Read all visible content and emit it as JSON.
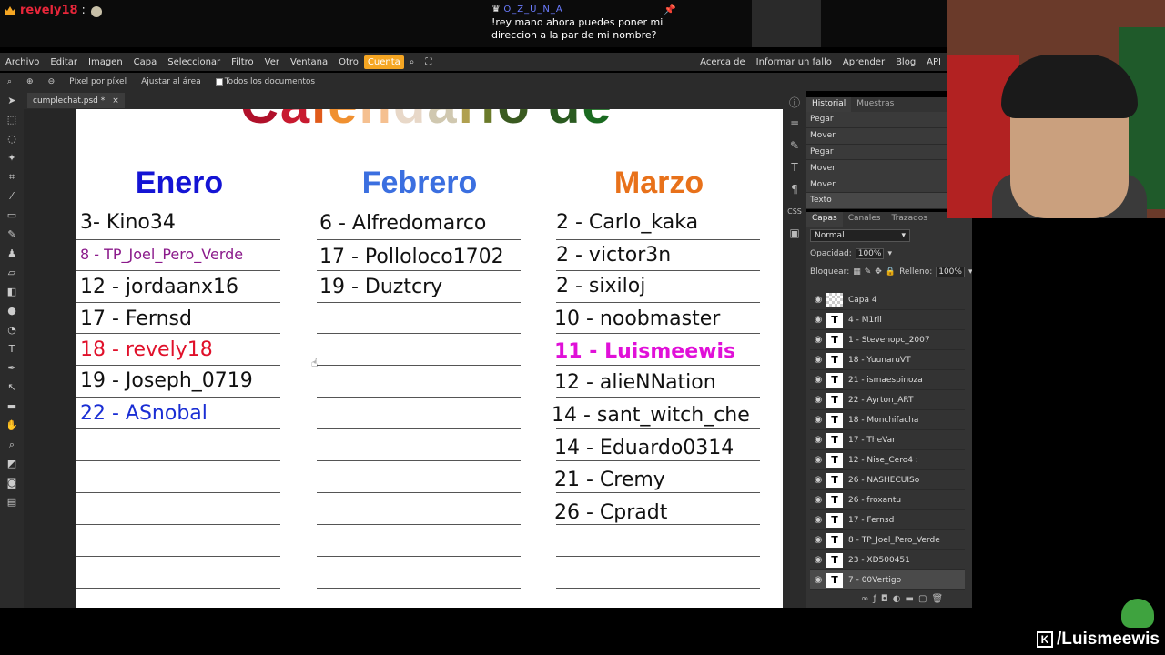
{
  "chat": {
    "msg1_user": "revely18",
    "msg1_sep": ":",
    "msg2_user": "O_Z_U_N_A",
    "msg2_text": "!rey mano ahora puedes poner mi direccion a la par de mi nombre?"
  },
  "menubar": {
    "items": [
      "Archivo",
      "Editar",
      "Imagen",
      "Capa",
      "Seleccionar",
      "Filtro",
      "Ver",
      "Ventana",
      "Otro",
      "Cuenta"
    ],
    "right_items": [
      "Acerca de",
      "Informar un fallo",
      "Aprender",
      "Blog",
      "API"
    ]
  },
  "options": {
    "pixel": "Píxel por píxel",
    "fit": "Ajustar al área",
    "all_docs": "Todos los documentos"
  },
  "document": {
    "tab_title": "cumplechat.psd *",
    "close": "×"
  },
  "canvas": {
    "months": [
      {
        "title": "Enero",
        "color": "#1414d4",
        "entries": [
          {
            "text": "3- Kino34",
            "color": "#111"
          },
          {
            "text": "8 - TP_Joel_Pero_Verde",
            "color": "#8b1a8b"
          },
          {
            "text": "12 - jordaanx16",
            "color": "#111"
          },
          {
            "text": "17 - Fernsd",
            "color": "#111"
          },
          {
            "text": "18 - revely18",
            "color": "#e0102a"
          },
          {
            "text": "19 - Joseph_0719",
            "color": "#111"
          },
          {
            "text": "22 - ASnobal",
            "color": "#1a2ed4"
          }
        ]
      },
      {
        "title": "Febrero",
        "color": "#3b6fe0",
        "entries": [
          {
            "text": "6 - Alfredomarco",
            "color": "#111"
          },
          {
            "text": "17 - Pollolоco1702",
            "color": "#111"
          },
          {
            "text": "19 - Duztcry",
            "color": "#111"
          }
        ]
      },
      {
        "title": "Marzo",
        "color": "#e8711a",
        "entries": [
          {
            "text": "2 - Carlo_kaka",
            "color": "#111"
          },
          {
            "text": "2 - victor3n",
            "color": "#111"
          },
          {
            "text": "2 - sixiloj",
            "color": "#111"
          },
          {
            "text": "10 - noobmaster",
            "color": "#111"
          },
          {
            "text": "11 - Luismeewis",
            "color": "#e010d8"
          },
          {
            "text": "12 - alieNNation",
            "color": "#111"
          },
          {
            "text": "14 - sant_witch_che",
            "color": "#111"
          },
          {
            "text": "14 - Eduardo0314",
            "color": "#111"
          },
          {
            "text": "21 - Cremy",
            "color": "#111"
          },
          {
            "text": "26 - Cpradt",
            "color": "#111"
          }
        ]
      }
    ]
  },
  "history": {
    "tabs": [
      "Historial",
      "Muestras"
    ],
    "items": [
      "Pegar",
      "Mover",
      "Pegar",
      "Mover",
      "Mover",
      "Texto"
    ]
  },
  "layers_panel": {
    "tabs": [
      "Capas",
      "Canales",
      "Trazados"
    ],
    "blend_mode": "Normal",
    "opacity_label": "Opacidad:",
    "opacity_value": "100%",
    "lock_label": "Bloquear:",
    "fill_label": "Relleno:",
    "fill_value": "100%",
    "layers": [
      {
        "name": "Capa 4",
        "type": "raster"
      },
      {
        "name": "4 - M1rii",
        "type": "text"
      },
      {
        "name": "1 - Stevenopc_2007",
        "type": "text"
      },
      {
        "name": "18 - YuunaruVT",
        "type": "text"
      },
      {
        "name": "21 - ismaespinoza",
        "type": "text"
      },
      {
        "name": "22 - Ayrton_ART",
        "type": "text"
      },
      {
        "name": "18 - Monchifacha",
        "type": "text"
      },
      {
        "name": "17 - TheVar",
        "type": "text"
      },
      {
        "name": "12 - Nise_Cero4 :",
        "type": "text"
      },
      {
        "name": "26 - NASHECUISo",
        "type": "text"
      },
      {
        "name": "26 - froxantu",
        "type": "text"
      },
      {
        "name": "17 - Fernsd",
        "type": "text"
      },
      {
        "name": "8 - TP_Joel_Pero_Verde",
        "type": "text"
      },
      {
        "name": "23 - XD500451",
        "type": "text"
      },
      {
        "name": "7 - 00Vertigo",
        "type": "text"
      }
    ]
  },
  "overlay": {
    "handle": "/Luismeewis",
    "kick_glyph": "K"
  }
}
